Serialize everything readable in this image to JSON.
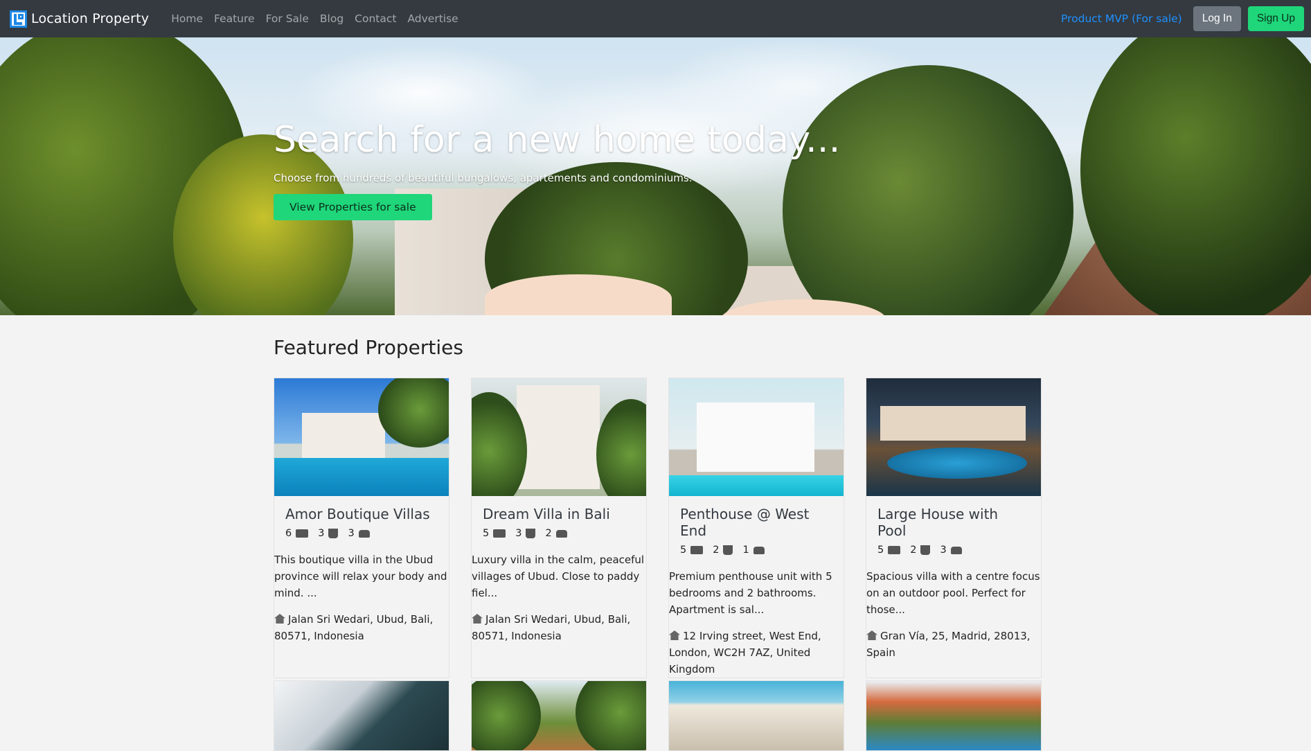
{
  "nav": {
    "brand": "Location Property",
    "links": [
      "Home",
      "Feature",
      "For Sale",
      "Blog",
      "Contact",
      "Advertise"
    ],
    "mvp_link": "Product MVP (For sale)",
    "login": "Log In",
    "signup": "Sign Up"
  },
  "hero": {
    "title": "Search for a new home today...",
    "subtitle": "Choose from hundreds of beautiful bungalows, apartements and condominiums.",
    "button": "View Properties for sale"
  },
  "featured": {
    "title": "Featured Properties",
    "properties": [
      {
        "name": "Amor Boutique Villas",
        "bedrooms": "6",
        "bathrooms": "3",
        "parking": "3",
        "description": "This boutique villa in the Ubud province will relax your body and mind. ...",
        "address": "Jalan Sri Wedari, Ubud, Bali, 80571, Indonesia"
      },
      {
        "name": "Dream Villa in Bali",
        "bedrooms": "5",
        "bathrooms": "3",
        "parking": "2",
        "description": "Luxury villa in the calm, peaceful villages of Ubud. Close to paddy fiel...",
        "address": "Jalan Sri Wedari, Ubud, Bali, 80571, Indonesia"
      },
      {
        "name": "Penthouse @ West End",
        "bedrooms": "5",
        "bathrooms": "2",
        "parking": "1",
        "description": "Premium penthouse unit with 5 bedrooms and 2 bathrooms. Apartment is sal...",
        "address": "12 Irving street, West End, London, WC2H 7AZ, United Kingdom"
      },
      {
        "name": "Large House with Pool",
        "bedrooms": "5",
        "bathrooms": "2",
        "parking": "3",
        "description": "Spacious villa with a centre focus on an outdoor pool. Perfect for those...",
        "address": "Gran Vía, 25, Madrid, 28013, Spain"
      }
    ]
  },
  "icons": {
    "bed": "bed-icon",
    "bath": "bath-icon",
    "car": "car-icon",
    "home": "home-icon"
  },
  "colors": {
    "navbar": "#343a40",
    "accent_green": "#1fd67a",
    "link_blue": "#1e90ff",
    "login_gray": "#6c757d"
  }
}
